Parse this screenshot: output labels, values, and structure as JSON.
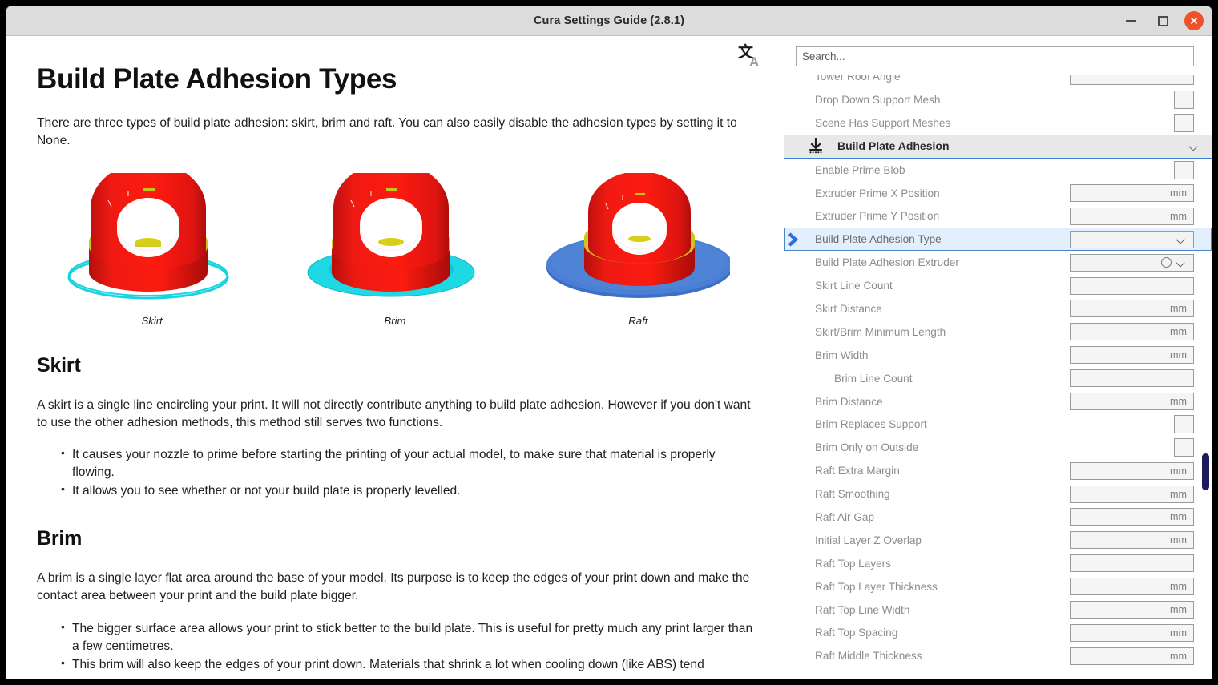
{
  "window": {
    "title": "Cura Settings Guide (2.8.1)",
    "minimize_label": "Minimize",
    "maximize_label": "Maximize",
    "close_label": "Close",
    "accent_close": "#ef512a"
  },
  "document": {
    "translate_icon_label": "Translate",
    "h1": "Build Plate Adhesion Types",
    "intro": "There are three types of build plate adhesion: skirt, brim and raft. You can also easily disable the adhesion types by setting it to None.",
    "figures": [
      {
        "caption": "Skirt"
      },
      {
        "caption": "Brim"
      },
      {
        "caption": "Raft"
      }
    ],
    "sections": [
      {
        "heading": "Skirt",
        "paragraph": "A skirt is a single line encircling your print. It will not directly contribute anything to build plate adhesion. However if you don't want to use the other adhesion methods, this method still serves two functions.",
        "bullets": [
          "It causes your nozzle to prime before starting the printing of your actual model, to make sure that material is properly flowing.",
          "It allows you to see whether or not your build plate is properly levelled."
        ]
      },
      {
        "heading": "Brim",
        "paragraph": "A brim is a single layer flat area around the base of your model. Its purpose is to keep the edges of your print down and make the contact area between your print and the build plate bigger.",
        "bullets": [
          "The bigger surface area allows your print to stick better to the build plate. This is useful for pretty much any print larger than a few centimetres.",
          "This brim will also keep the edges of your print down. Materials that shrink a lot when cooling down (like ABS) tend"
        ]
      }
    ]
  },
  "settings": {
    "search": {
      "placeholder": "Search...",
      "value": ""
    },
    "category": {
      "label": "Build Plate Adhesion",
      "icon": "build-plate-adhesion-icon",
      "expanded": true,
      "accent": "#3d7bd6"
    },
    "selected_row": "Build Plate Adhesion Type",
    "rows_before_category": [
      {
        "label": "Tower Roof Angle",
        "control": "text",
        "unit": "",
        "partial": true
      },
      {
        "label": "Drop Down Support Mesh",
        "control": "checkbox",
        "unit": ""
      },
      {
        "label": "Scene Has Support Meshes",
        "control": "checkbox",
        "unit": ""
      }
    ],
    "rows_after_category": [
      {
        "label": "Enable Prime Blob",
        "control": "checkbox",
        "unit": ""
      },
      {
        "label": "Extruder Prime X Position",
        "control": "text",
        "unit": "mm"
      },
      {
        "label": "Extruder Prime Y Position",
        "control": "text",
        "unit": "mm"
      },
      {
        "label": "Build Plate Adhesion Type",
        "control": "combo",
        "unit": "",
        "selected": true
      },
      {
        "label": "Build Plate Adhesion Extruder",
        "control": "extruder-combo",
        "unit": ""
      },
      {
        "label": "Skirt Line Count",
        "control": "text",
        "unit": ""
      },
      {
        "label": "Skirt Distance",
        "control": "text",
        "unit": "mm"
      },
      {
        "label": "Skirt/Brim Minimum Length",
        "control": "text",
        "unit": "mm"
      },
      {
        "label": "Brim Width",
        "control": "text",
        "unit": "mm"
      },
      {
        "label": "Brim Line Count",
        "control": "text",
        "unit": "",
        "indent": true
      },
      {
        "label": "Brim Distance",
        "control": "text",
        "unit": "mm"
      },
      {
        "label": "Brim Replaces Support",
        "control": "checkbox",
        "unit": ""
      },
      {
        "label": "Brim Only on Outside",
        "control": "checkbox",
        "unit": ""
      },
      {
        "label": "Raft Extra Margin",
        "control": "text",
        "unit": "mm"
      },
      {
        "label": "Raft Smoothing",
        "control": "text",
        "unit": "mm"
      },
      {
        "label": "Raft Air Gap",
        "control": "text",
        "unit": "mm"
      },
      {
        "label": "Initial Layer Z Overlap",
        "control": "text",
        "unit": "mm"
      },
      {
        "label": "Raft Top Layers",
        "control": "text",
        "unit": ""
      },
      {
        "label": "Raft Top Layer Thickness",
        "control": "text",
        "unit": "mm"
      },
      {
        "label": "Raft Top Line Width",
        "control": "text",
        "unit": "mm"
      },
      {
        "label": "Raft Top Spacing",
        "control": "text",
        "unit": "mm"
      },
      {
        "label": "Raft Middle Thickness",
        "control": "text",
        "unit": "mm"
      }
    ],
    "scrollbar": {
      "color": "#1b1b5e",
      "position_pct": 68
    }
  }
}
